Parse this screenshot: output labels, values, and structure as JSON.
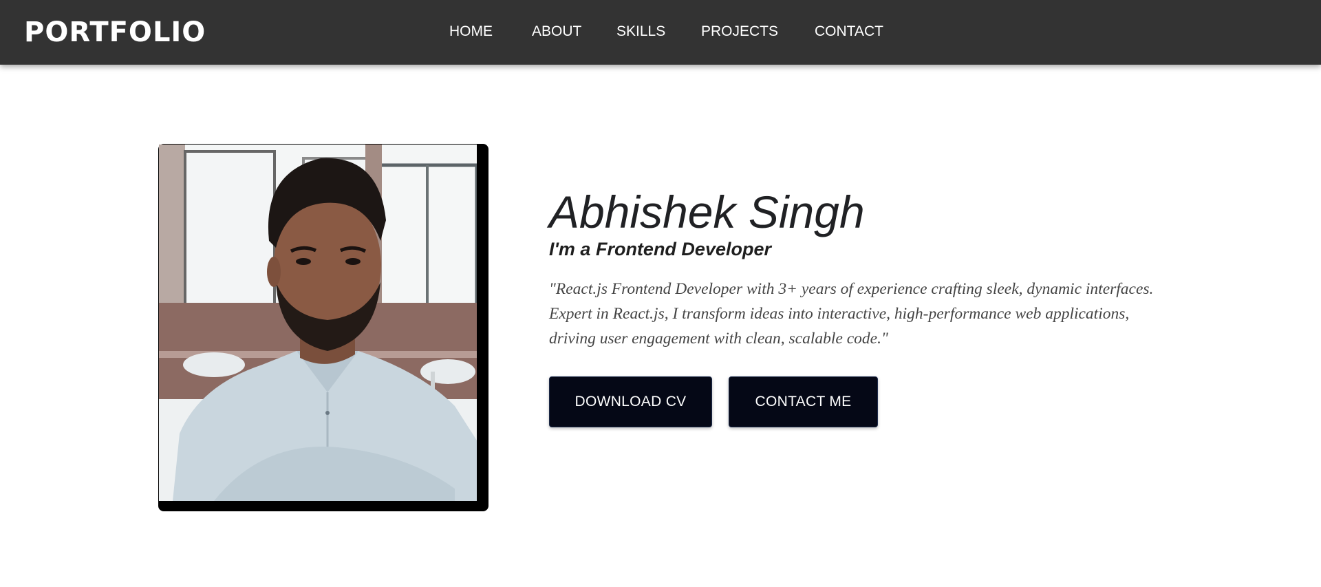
{
  "navbar": {
    "logo": "PORTFOLIO",
    "links": [
      {
        "label": "HOME"
      },
      {
        "label": "ABOUT"
      },
      {
        "label": "SKILLS"
      },
      {
        "label": "PROJECTS"
      },
      {
        "label": "CONTACT"
      }
    ],
    "background_color": "#333333",
    "text_color": "#ffffff"
  },
  "hero": {
    "photo_icon": "profile-photo",
    "name": "Abhishek Singh",
    "role": "I'm a Frontend Developer",
    "bio": "\"React.js Frontend Developer with 3+ years of experience crafting sleek, dynamic interfaces. Expert in React.js, I transform ideas into interactive, high-performance web applications, driving user engagement with clean, scalable code.\"",
    "buttons": {
      "download_cv": "DOWNLOAD CV",
      "contact_me": "CONTACT ME"
    },
    "button_color": "#050816"
  }
}
